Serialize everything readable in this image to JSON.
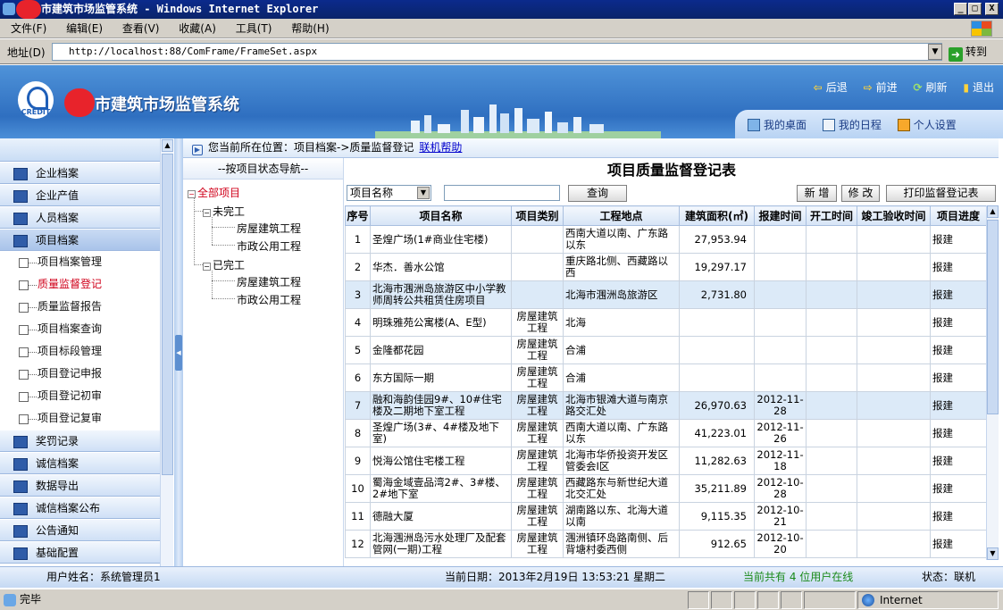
{
  "window": {
    "title": "市建筑市场监管系统 - Windows Internet Explorer",
    "controls": [
      "_",
      "□",
      "X"
    ]
  },
  "menu": [
    "文件(F)",
    "编辑(E)",
    "查看(V)",
    "收藏(A)",
    "工具(T)",
    "帮助(H)"
  ],
  "address": {
    "label": "地址(D)",
    "url": "http://localhost:88/ComFrame/FrameSet.aspx",
    "go_label": "转到"
  },
  "banner": {
    "logo_text": "CREDIT",
    "system_title": "市建筑市场监管系统",
    "nav": [
      "后退",
      "前进",
      "刷新",
      "退出"
    ],
    "desk_tabs": [
      "我的桌面",
      "我的日程",
      "个人设置"
    ]
  },
  "sidebar": {
    "groups_top": [
      "企业档案",
      "企业产值",
      "人员档案",
      "项目档案"
    ],
    "sub_items": [
      "项目档案管理",
      "质量监督登记",
      "质量监督报告",
      "项目档案查询",
      "项目标段管理",
      "项目登记申报",
      "项目登记初审",
      "项目登记复审"
    ],
    "groups_bottom": [
      "奖罚记录",
      "诚信档案",
      "数据导出",
      "诚信档案公布",
      "公告通知",
      "基础配置"
    ]
  },
  "breadcrumb": {
    "text": "您当前所在位置：项目档案->质量监督登记",
    "help_link": "联机帮助"
  },
  "tree": {
    "header": "--按项目状态导航--",
    "root": "全部项目",
    "unfinished": "未完工",
    "finished": "已完工",
    "leaf_building": "房屋建筑工程",
    "leaf_municipal": "市政公用工程"
  },
  "main": {
    "title": "项目质量监督登记表",
    "search_field": "项目名称",
    "search_value": "",
    "search_button": "查询",
    "add_button": "新 增",
    "edit_button": "修 改",
    "print_button": "打印监督登记表"
  },
  "table": {
    "headers": [
      "序号",
      "项目名称",
      "项目类别",
      "工程地点",
      "建筑面积(㎡)",
      "报建时间",
      "开工时间",
      "竣工验收时间",
      "项目进度"
    ],
    "rows": [
      [
        "1",
        "圣煌广场(1#商业住宅楼)",
        "",
        "西南大道以南、广东路以东",
        "27,953.94",
        "",
        "",
        "",
        "报建"
      ],
      [
        "2",
        "华杰．善水公馆",
        "",
        "重庆路北侧、西藏路以西",
        "19,297.17",
        "",
        "",
        "",
        "报建"
      ],
      [
        "3",
        "北海市涠洲岛旅游区中小学教师周转公共租赁住房项目",
        "",
        "北海市涠洲岛旅游区",
        "2,731.80",
        "",
        "",
        "",
        "报建"
      ],
      [
        "4",
        "明珠雅苑公寓楼(A、E型)",
        "房屋建筑工程",
        "北海",
        "",
        "",
        "",
        "",
        "报建"
      ],
      [
        "5",
        "金隆都花园",
        "房屋建筑工程",
        "合浦",
        "",
        "",
        "",
        "",
        "报建"
      ],
      [
        "6",
        "东方国际一期",
        "房屋建筑工程",
        "合浦",
        "",
        "",
        "",
        "",
        "报建"
      ],
      [
        "7",
        "融和海韵佳园9#、10#住宅楼及二期地下室工程",
        "房屋建筑工程",
        "北海市银滩大道与南京路交汇处",
        "26,970.63",
        "2012-11-28",
        "",
        "",
        "报建"
      ],
      [
        "8",
        "圣煌广场(3#、4#楼及地下室)",
        "房屋建筑工程",
        "西南大道以南、广东路以东",
        "41,223.01",
        "2012-11-26",
        "",
        "",
        "报建"
      ],
      [
        "9",
        "悦海公馆住宅楼工程",
        "房屋建筑工程",
        "北海市华侨投资开发区管委会I区",
        "11,282.63",
        "2012-11-18",
        "",
        "",
        "报建"
      ],
      [
        "10",
        "蜀海金域壹品湾2#、3#楼、2#地下室",
        "房屋建筑工程",
        "西藏路东与新世纪大道北交汇处",
        "35,211.89",
        "2012-10-28",
        "",
        "",
        "报建"
      ],
      [
        "11",
        "德融大厦",
        "房屋建筑工程",
        "湖南路以东、北海大道以南",
        "9,115.35",
        "2012-10-21",
        "",
        "",
        "报建"
      ],
      [
        "12",
        "北海涠洲岛污水处理厂及配套管网(一期)工程",
        "房屋建筑工程",
        "涠洲镇环岛路南侧、后背塘村委西侧",
        "912.65",
        "2012-10-20",
        "",
        "",
        "报建"
      ]
    ]
  },
  "app_status": {
    "user": "用户姓名：系统管理员1",
    "date": "当前日期：2013年2月19日 13:53:21 星期二",
    "online": "当前共有 4 位用户在线",
    "state": "状态：联机"
  },
  "ie_status": {
    "left": "完毕",
    "zone": "Internet"
  }
}
